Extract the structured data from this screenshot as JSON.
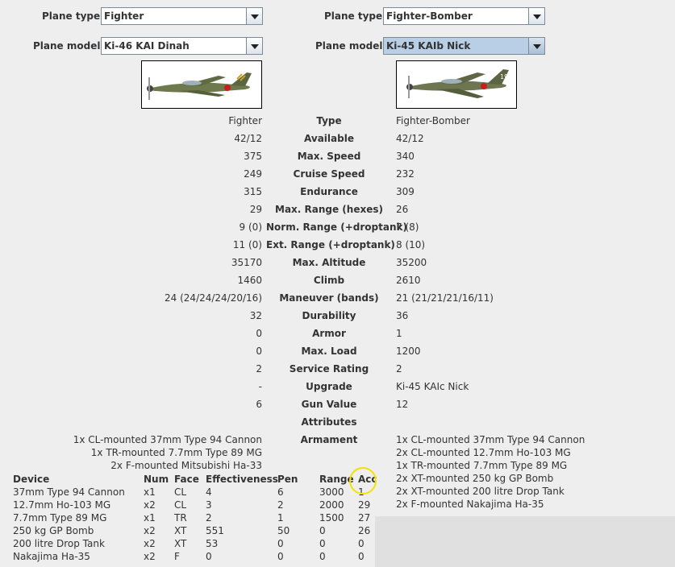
{
  "left": {
    "plane_type_label": "Plane type:",
    "plane_type_value": "Fighter",
    "plane_model_label": "Plane model:",
    "plane_model_value": "Ki-46 KAI Dinah",
    "stats": [
      "Fighter",
      "42/12",
      "375",
      "249",
      "315",
      "29",
      "9 (0)",
      "11 (0)",
      "35170",
      "1460",
      "24 (24/24/24/20/16)",
      "32",
      "0",
      "0",
      "2",
      "-",
      "6"
    ],
    "armament": [
      "1x CL-mounted 37mm Type 94 Cannon",
      "1x TR-mounted 7.7mm Type 89 MG",
      "2x F-mounted Mitsubishi Ha-33"
    ]
  },
  "right": {
    "plane_type_label": "Plane type:",
    "plane_type_value": "Fighter-Bomber",
    "plane_model_label": "Plane model:",
    "plane_model_value": "Ki-45 KAIb Nick",
    "stats": [
      "Fighter-Bomber",
      "42/12",
      "340",
      "232",
      "309",
      "26",
      "7 (8)",
      "8 (10)",
      "35200",
      "2610",
      "21 (21/21/21/16/11)",
      "36",
      "1",
      "1200",
      "2",
      "Ki-45 KAIc Nick",
      "12"
    ],
    "armament": [
      "1x CL-mounted 37mm Type 94 Cannon",
      "2x CL-mounted 12.7mm Ho-103 MG",
      "1x TR-mounted 7.7mm Type 89 MG",
      "2x XT-mounted 250 kg GP Bomb",
      "2x XT-mounted 200 litre Drop Tank",
      "2x F-mounted Nakajima Ha-35"
    ]
  },
  "stat_labels": [
    "Type",
    "Available",
    "Max. Speed",
    "Cruise Speed",
    "Endurance",
    "Max. Range (hexes)",
    "Norm. Range (+droptank)",
    "Ext. Range (+droptank)",
    "Max. Altitude",
    "Climb",
    "Maneuver (bands)",
    "Durability",
    "Armor",
    "Max. Load",
    "Service Rating",
    "Upgrade",
    "Gun Value",
    "Attributes",
    "Armament"
  ],
  "device_table": {
    "headers": [
      "Device",
      "Num",
      "Face",
      "Effectiveness",
      "Pen",
      "Range",
      "Acc"
    ],
    "rows": [
      [
        "37mm Type 94 Cannon",
        "x1",
        "CL",
        "4",
        "6",
        "3000",
        "1"
      ],
      [
        "12.7mm Ho-103 MG",
        "x2",
        "CL",
        "3",
        "2",
        "2000",
        "29"
      ],
      [
        "7.7mm Type 89 MG",
        "x1",
        "TR",
        "2",
        "1",
        "1500",
        "27"
      ],
      [
        "250 kg GP Bomb",
        "x2",
        "XT",
        "551",
        "50",
        "0",
        "26"
      ],
      [
        "200 litre Drop Tank",
        "x2",
        "XT",
        "53",
        "0",
        "0",
        "0"
      ],
      [
        "Nakajima Ha-35",
        "x2",
        "F",
        "0",
        "0",
        "0",
        "0"
      ]
    ]
  },
  "icons": {
    "left_plane": "plane-ki46-image",
    "right_plane": "plane-ki45-image",
    "highlight": "yellow-circle-annotation"
  },
  "colors": {
    "background": "#eeeeee",
    "combo_selected": "#b8cfe5",
    "highlight": "#f2e300"
  }
}
